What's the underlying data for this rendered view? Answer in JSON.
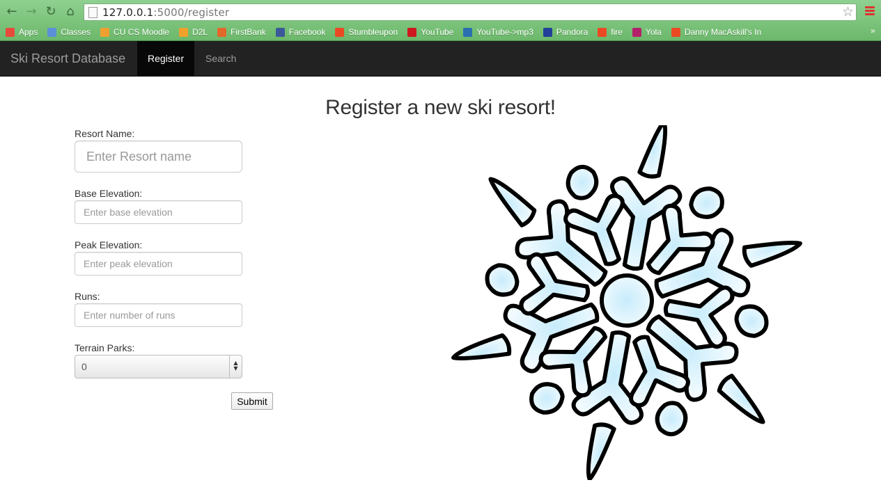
{
  "browser": {
    "url_host": "127.0.0.1",
    "url_path": ":5000/register",
    "bookmarks": [
      {
        "label": "Apps",
        "icon": "apps-grid-icon",
        "color": "#e84b3c"
      },
      {
        "label": "Classes",
        "icon": "folder-icon",
        "color": "#5b8fd6"
      },
      {
        "label": "CU CS Moodle",
        "icon": "moodle-icon",
        "color": "#f0a030"
      },
      {
        "label": "D2L",
        "icon": "d2l-icon",
        "color": "#f2a12b"
      },
      {
        "label": "FirstBank",
        "icon": "firstbank-icon",
        "color": "#e4672a"
      },
      {
        "label": "Facebook",
        "icon": "facebook-icon",
        "color": "#3b5998"
      },
      {
        "label": "Stumbleupon",
        "icon": "stumbleupon-icon",
        "color": "#eb4924"
      },
      {
        "label": "YouTube",
        "icon": "youtube-icon",
        "color": "#cc181e"
      },
      {
        "label": "YouTube->mp3",
        "icon": "youtube-mp3-icon",
        "color": "#2a6fb0"
      },
      {
        "label": "Pandora",
        "icon": "pandora-icon",
        "color": "#224099"
      },
      {
        "label": "fire",
        "icon": "stumbleupon-icon",
        "color": "#eb4924"
      },
      {
        "label": "Yola",
        "icon": "yola-icon",
        "color": "#b3206a"
      },
      {
        "label": "Danny MacAskill's In",
        "icon": "stumbleupon-icon",
        "color": "#eb4924"
      }
    ],
    "more": "»"
  },
  "navbar": {
    "brand": "Ski Resort Database",
    "items": [
      {
        "label": "Register",
        "active": true
      },
      {
        "label": "Search",
        "active": false
      }
    ]
  },
  "page": {
    "title": "Register a new ski resort!"
  },
  "form": {
    "resort_name": {
      "label": "Resort Name:",
      "placeholder": "Enter Resort name"
    },
    "base_elevation": {
      "label": "Base Elevation:",
      "placeholder": "Enter base elevation"
    },
    "peak_elevation": {
      "label": "Peak Elevation:",
      "placeholder": "Enter peak elevation"
    },
    "runs": {
      "label": "Runs:",
      "placeholder": "Enter number of runs"
    },
    "terrain_parks": {
      "label": "Terrain Parks:",
      "value": "0"
    },
    "submit_label": "Submit"
  },
  "colors": {
    "navbar_bg": "#222222",
    "snowflake_fill": "#dff4fd",
    "snowflake_stroke": "#000000"
  }
}
